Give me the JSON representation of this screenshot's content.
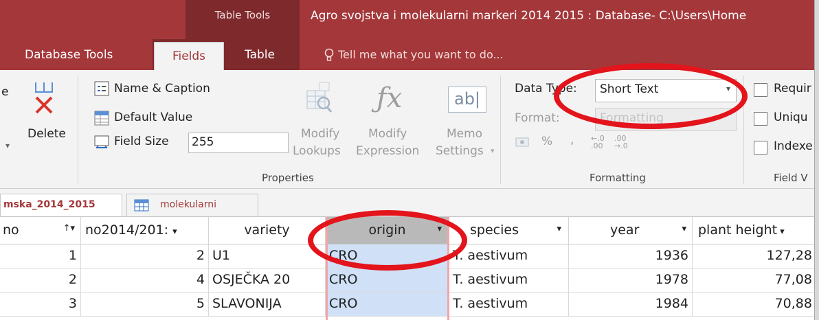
{
  "titlebar": {
    "context_label": "Table Tools",
    "window_title": "Agro svojstva i molekularni markeri 2014 2015 : Database- C:\\Users\\Home"
  },
  "tabs": {
    "database_tools": "Database Tools",
    "fields": "Fields",
    "table": "Table",
    "tell_me": "Tell me what you want to do..."
  },
  "ribbon": {
    "partial_left": "e",
    "delete_label": "Delete",
    "name_caption": "Name & Caption",
    "default_value": "Default Value",
    "field_size_label": "Field Size",
    "field_size_value": "255",
    "modify_lookups": [
      "Modify",
      "Lookups"
    ],
    "modify_expression": [
      "Modify",
      "Expression"
    ],
    "memo_settings": [
      "Memo",
      "Settings"
    ],
    "properties_group": "Properties",
    "data_type_label": "Data Type:",
    "data_type_value": "Short Text",
    "format_label": "Format:",
    "format_value": "Formatting",
    "formatting_group": "Formatting",
    "required": "Requir",
    "unique": "Uniqu",
    "indexed": "Indexe",
    "field_validation_group": "Field V",
    "percent": "%",
    "comma": ",",
    "dec_inc": "←.0 .00",
    "dec_dec": ".00 →.0"
  },
  "object_tabs": [
    {
      "label": "mska_2014_2015"
    },
    {
      "label": "molekularni"
    }
  ],
  "table": {
    "columns": [
      "no",
      "no2014/201:",
      "variety",
      "origin",
      "species",
      "year",
      "plant height"
    ],
    "rows": [
      {
        "no": "1",
        "no2014": "2",
        "variety": "U1",
        "origin": "CRO",
        "species": "T. aestivum",
        "year": "1936",
        "plant_height": "127,28"
      },
      {
        "no": "2",
        "no2014": "4",
        "variety": "OSJEČKA 20",
        "origin": "CRO",
        "species": "T. aestivum",
        "year": "1978",
        "plant_height": "77,08"
      },
      {
        "no": "3",
        "no2014": "5",
        "variety": "SLAVONIJA",
        "origin": "CRO",
        "species": "T. aestivum",
        "year": "1984",
        "plant_height": "70,88"
      }
    ]
  },
  "colors": {
    "access_red": "#a4373a",
    "context_dark": "#7e2a2d",
    "annotation_red": "#e3141b",
    "selected_column": "#cfe0f7"
  },
  "icons": [
    "delete-icon",
    "name-caption-icon",
    "default-value-icon",
    "field-size-icon",
    "modify-lookups-icon",
    "fx-icon",
    "memo-ab-icon",
    "lightbulb-icon",
    "table-icon",
    "dropdown-arrow-icon",
    "sort-arrow-icon"
  ]
}
